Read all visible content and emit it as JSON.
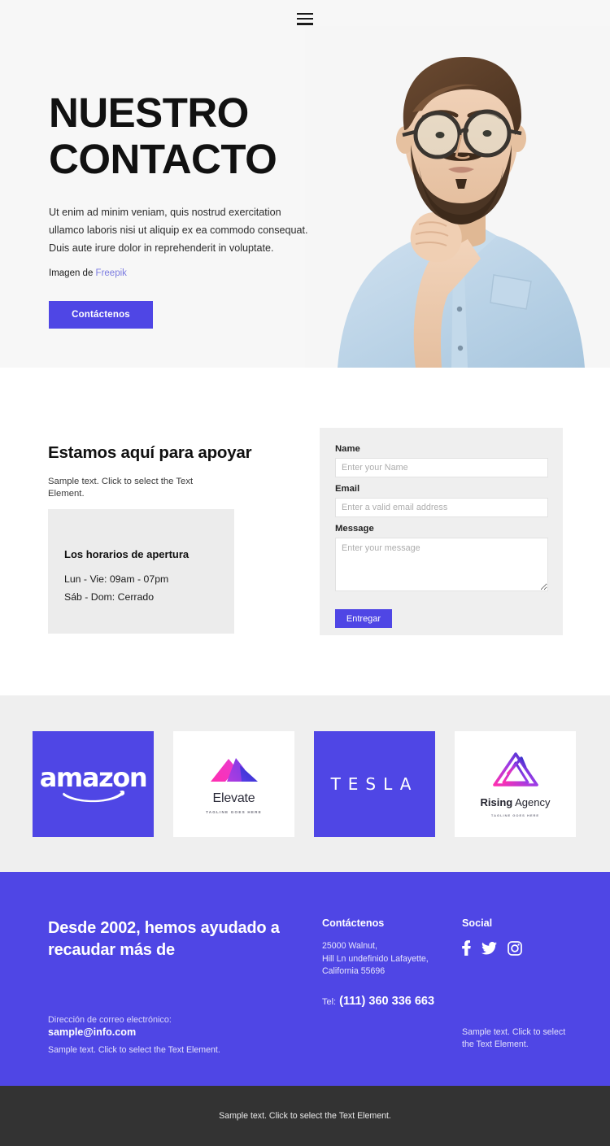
{
  "nav": {
    "menu_icon": "hamburger-menu-icon"
  },
  "hero": {
    "title_line1": "NUESTRO",
    "title_line2": "CONTACTO",
    "paragraph": "Ut enim ad minim veniam, quis nostrud exercitation ullamco laboris nisi ut aliquip ex ea commodo consequat. Duis aute irure dolor in reprehenderit in voluptate.",
    "credit_prefix": "Imagen de ",
    "credit_link": "Freepik",
    "cta_label": "Contáctenos",
    "photo_alt": "bearded-man-with-glasses-thinking"
  },
  "support": {
    "title": "Estamos aquí para apoyar",
    "subtitle": "Sample text. Click to select the Text Element.",
    "hours": {
      "title": "Los horarios de apertura",
      "weekday": "Lun - Vie: 09am - 07pm",
      "weekend": "Sáb - Dom: Cerrado"
    }
  },
  "form": {
    "name_label": "Name",
    "name_placeholder": "Enter your Name",
    "email_label": "Email",
    "email_placeholder": "Enter a valid email address",
    "message_label": "Message",
    "message_placeholder": "Enter your message",
    "submit_label": "Entregar"
  },
  "logos": [
    {
      "name": "amazon",
      "style": "purple",
      "text": "amazon"
    },
    {
      "name": "Elevate",
      "style": "white",
      "text": "Elevate",
      "tagline": "TAGLINE GOES HERE"
    },
    {
      "name": "TESLA",
      "style": "purple",
      "text": "TESLA"
    },
    {
      "name": "Rising Agency",
      "style": "white",
      "text_bold": "Rising",
      "text_light": " Agency",
      "tagline": "TAGLINE GOES HERE"
    }
  ],
  "footer": {
    "headline": "Desde 2002, hemos ayudado a recaudar más de",
    "email_label": "Dirección de correo electrónico:",
    "email_value": "sample@info.com",
    "left_note": "Sample text. Click to select the Text Element.",
    "contact_title": "Contáctenos",
    "address_line1": "25000 Walnut,",
    "address_line2": "Hill Ln undefinido Lafayette,",
    "address_line3": "California 55696",
    "tel_label": "Tel:",
    "tel_value": "(111) 360 336 663",
    "social_title": "Social",
    "social_icons": [
      "facebook-icon",
      "twitter-icon",
      "instagram-icon"
    ],
    "social_note": "Sample text. Click to select the Text Element."
  },
  "bottombar": {
    "text": "Sample text. Click to select the Text Element."
  },
  "colors": {
    "accent": "#4f46e5",
    "hero_bg": "#f7f7f7",
    "card_bg": "#efefef",
    "hours_bg": "#ececec",
    "dark_bar": "#333333",
    "link": "#7b7be0"
  }
}
